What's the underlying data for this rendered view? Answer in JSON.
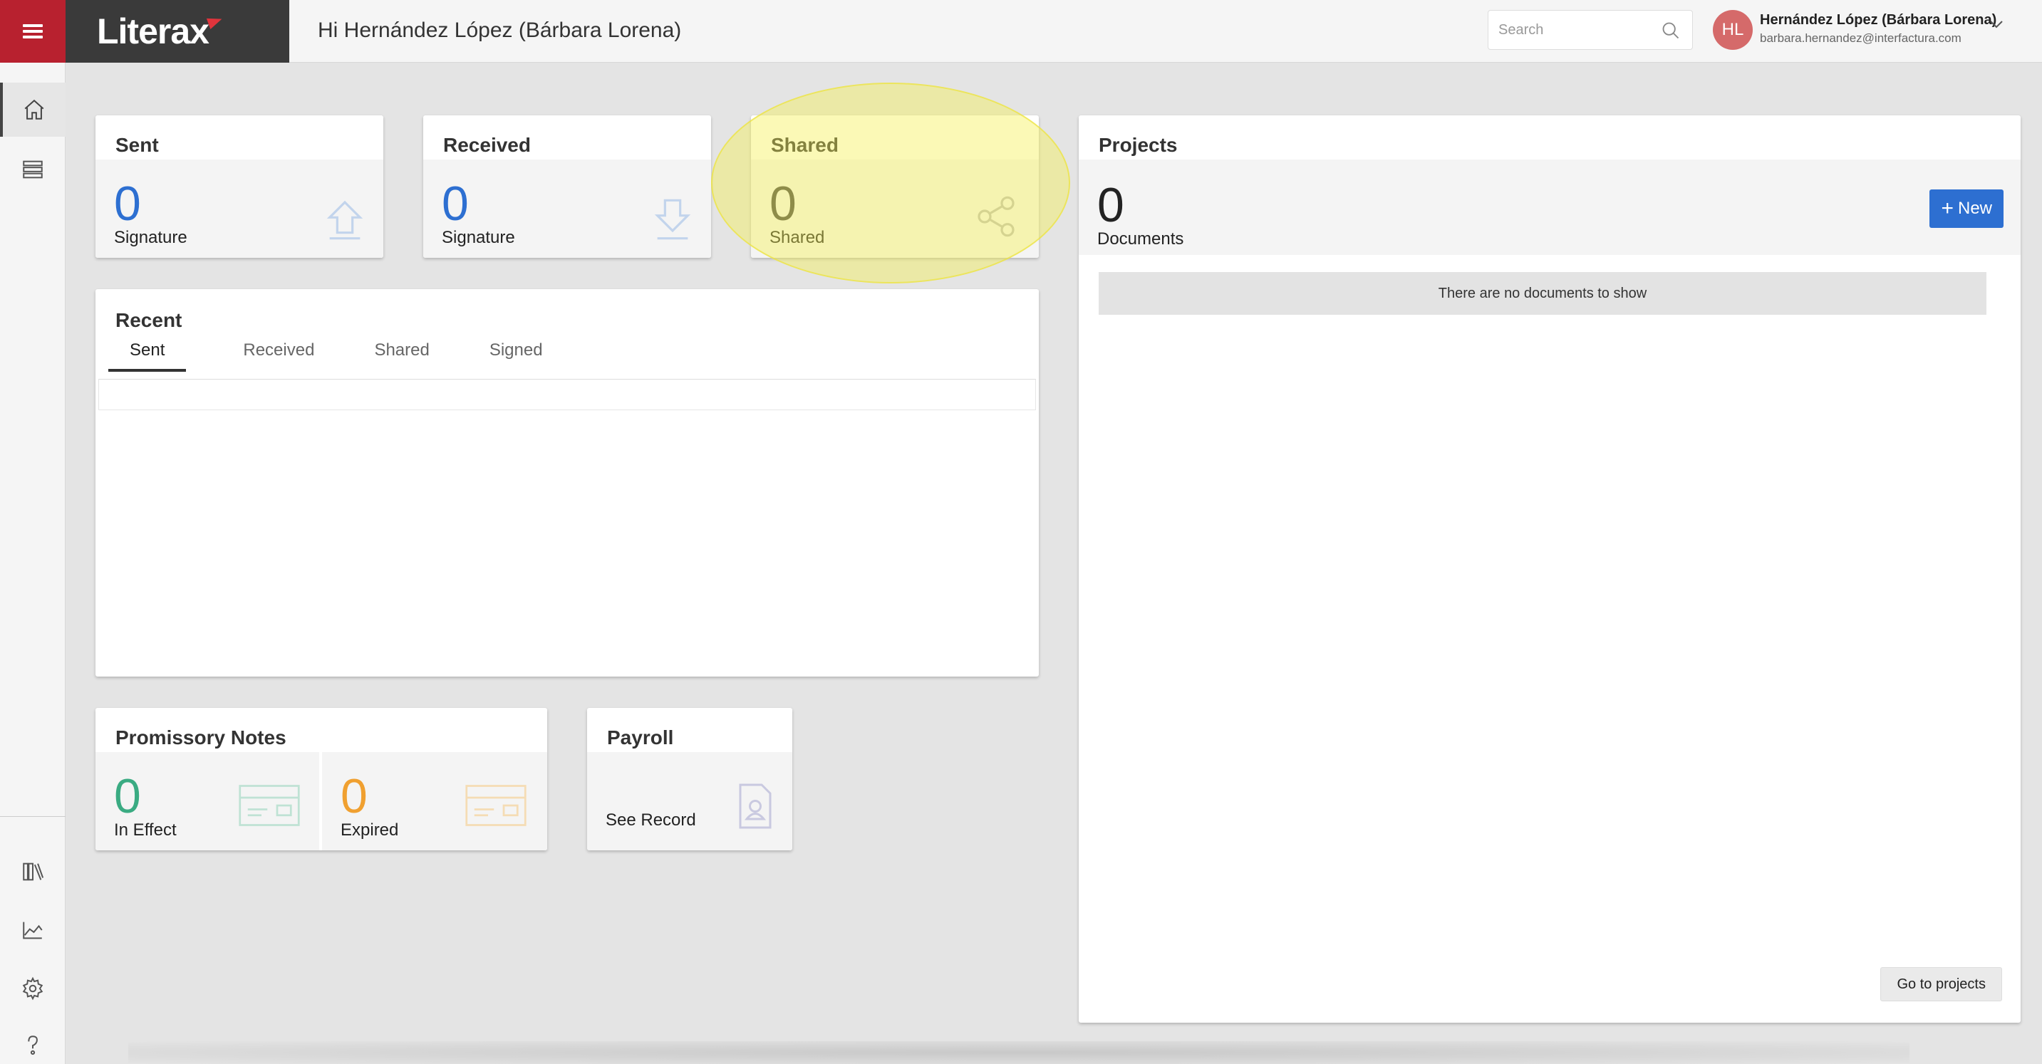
{
  "app": {
    "brand": "Literax",
    "greeting": "Hi Hernández López (Bárbara Lorena)"
  },
  "search": {
    "placeholder": "Search"
  },
  "user": {
    "initials": "HL",
    "name": "Hernández López (Bárbara Lorena)",
    "email": "barbara.hernandez@interfactura.com"
  },
  "sidebar": {
    "items": [
      {
        "icon": "home-icon",
        "active": true
      },
      {
        "icon": "list-icon"
      },
      {
        "icon": "library-icon"
      },
      {
        "icon": "chart-icon"
      },
      {
        "icon": "gear-icon"
      },
      {
        "icon": "help-icon"
      }
    ]
  },
  "cards": {
    "sent": {
      "title": "Sent",
      "count": "0",
      "label": "Signature",
      "icon": "upload-arrow-icon",
      "color": "#2d6fd1"
    },
    "received": {
      "title": "Received",
      "count": "0",
      "label": "Signature",
      "icon": "download-arrow-icon",
      "color": "#2d6fd1"
    },
    "shared": {
      "title": "Shared",
      "count": "0",
      "label": "Shared",
      "icon": "share-icon"
    }
  },
  "recent": {
    "title": "Recent",
    "tabs": [
      "Sent",
      "Received",
      "Shared",
      "Signed"
    ],
    "active_tab": "Sent"
  },
  "promissory": {
    "title": "Promissory Notes",
    "in_effect": {
      "count": "0",
      "label": "In Effect",
      "color": "#3aab82"
    },
    "expired": {
      "count": "0",
      "label": "Expired",
      "color": "#f0a030"
    }
  },
  "payroll": {
    "title": "Payroll",
    "link": "See Record"
  },
  "projects": {
    "title": "Projects",
    "count": "0",
    "count_label": "Documents",
    "new_label": "New",
    "empty": "There are no documents to show",
    "go_label": "Go to projects"
  },
  "colors": {
    "brand_red": "#b8212f",
    "primary_blue": "#2d6fd1",
    "highlight": "#f6f050"
  }
}
